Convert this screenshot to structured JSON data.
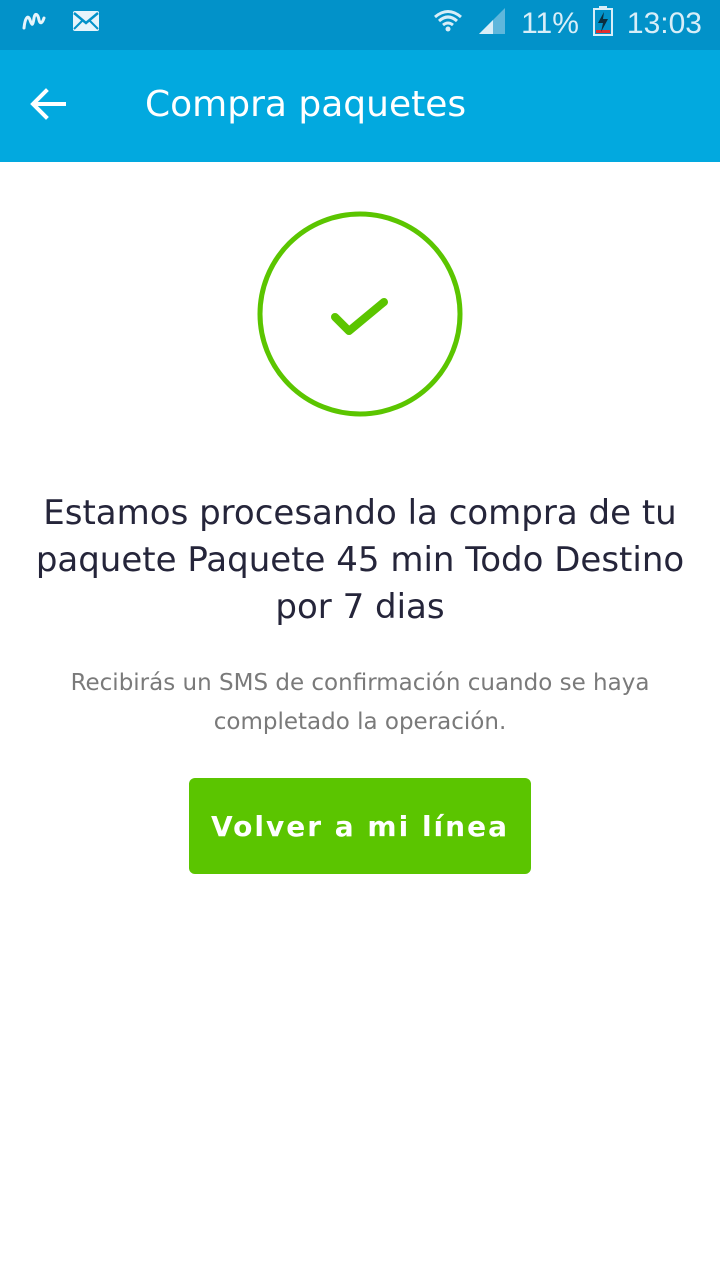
{
  "status_bar": {
    "battery_percent": "11%",
    "time": "13:03",
    "icons": [
      "movistar-logo-icon",
      "mail-icon",
      "wifi-icon",
      "signal-icon",
      "battery-charging-icon"
    ]
  },
  "app_bar": {
    "title": "Compra paquetes",
    "back_icon": "arrow-left-icon"
  },
  "confirmation": {
    "icon": "checkmark-icon",
    "headline": "Estamos procesando la compra de tu paquete Paquete 45 min Todo Destino por 7 dias",
    "message": "Recibirás un SMS de confirmación cuando se haya completado la operación.",
    "button_label": "Volver a mi línea"
  },
  "colors": {
    "status_bar": "#0292c9",
    "app_bar": "#02a9df",
    "accent_green": "#5bc500",
    "headline_text": "#25253a",
    "body_text": "#7a7a7a"
  }
}
